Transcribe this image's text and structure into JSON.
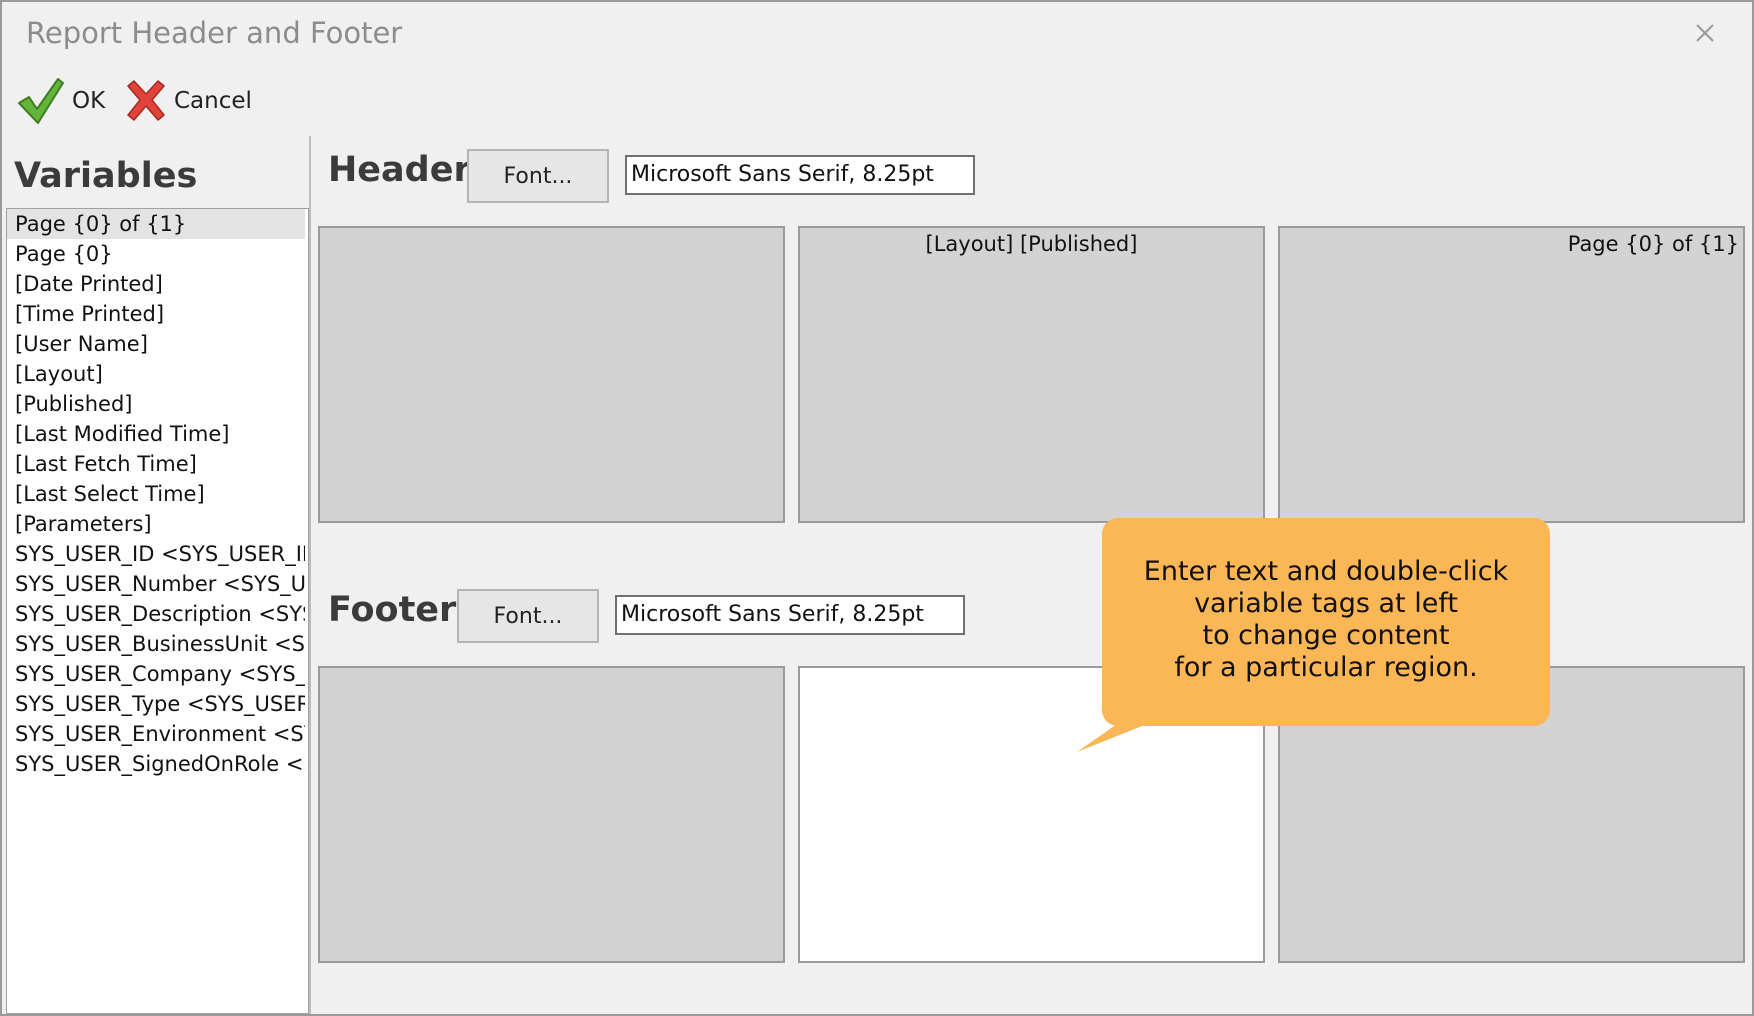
{
  "window": {
    "title": "Report Header and Footer"
  },
  "toolbar": {
    "ok_label": "OK",
    "cancel_label": "Cancel"
  },
  "variables": {
    "title": "Variables",
    "items": [
      "Page {0} of {1}",
      "Page {0}",
      "[Date Printed]",
      "[Time Printed]",
      "[User Name]",
      "[Layout]",
      "[Published]",
      "[Last Modified Time]",
      "[Last Fetch Time]",
      "[Last Select Time]",
      "[Parameters]",
      "SYS_USER_ID <SYS_USER_ID",
      "SYS_USER_Number <SYS_USER",
      "SYS_USER_Description <SYS_",
      "SYS_USER_BusinessUnit <SYS",
      "SYS_USER_Company <SYS_U",
      "SYS_USER_Type <SYS_USER_",
      "SYS_USER_Environment <SYS",
      "SYS_USER_SignedOnRole <SY"
    ],
    "selected_index": 0
  },
  "header": {
    "title": "Header",
    "font_button": "Font...",
    "font_value": "Microsoft Sans Serif, 8.25pt",
    "regions": {
      "left": "",
      "center": "[Layout] [Published]",
      "right": "Page {0} of {1}"
    }
  },
  "footer": {
    "title": "Footer",
    "font_button": "Font...",
    "font_value": "Microsoft Sans Serif, 8.25pt",
    "regions": {
      "left": "",
      "center": "",
      "right": ""
    }
  },
  "callout": {
    "text": "Enter text and double-click\nvariable tags at left\nto change content\nfor a particular region."
  },
  "colors": {
    "callout": "#fbb755",
    "region_bg": "#d3d3d3",
    "active_region_bg": "#ffffff"
  },
  "icons": {
    "ok": "green-checkmark-icon",
    "cancel": "red-x-icon",
    "close": "close-icon"
  }
}
